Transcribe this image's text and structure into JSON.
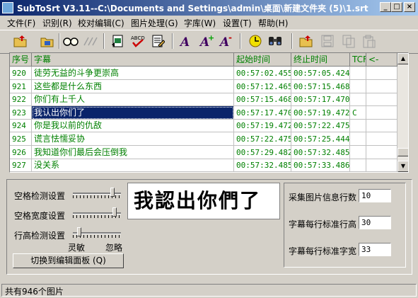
{
  "window": {
    "title": "SubToSrt V3.11--C:\\Documents and Settings\\admin\\桌面\\新建文件夹 (5)\\1.srt",
    "min_glyph": "_",
    "max_glyph": "□",
    "close_glyph": "×"
  },
  "menu": [
    "文件(F)",
    "识别(R)",
    "校对编辑(C)",
    "图片处理(G)",
    "字库(W)",
    "设置(T)",
    "帮助(H)"
  ],
  "toolbar_icons": [
    "open-folder-icon",
    "save-icon",
    "glasses-icon",
    "glasses-disabled-icon",
    "export-icon",
    "spellcheck-icon",
    "edit-doc-icon",
    "font-a-icon",
    "font-a-plus-icon",
    "font-a-minus-icon",
    "clock-icon",
    "binoculars-icon",
    "open-folder-2-icon",
    "disk-disabled-icon",
    "copy-disabled-icon",
    "paste-disabled-icon"
  ],
  "table": {
    "headers": [
      "序号",
      "字幕",
      "起始时间",
      "终止时间",
      "TCF",
      "<-"
    ],
    "rows": [
      {
        "no": "920",
        "text": "徒劳无益的斗争更崇高",
        "start": "00:57:02.455",
        "end": "00:57:05.424",
        "tcf": ""
      },
      {
        "no": "921",
        "text": "这些都是什么东西",
        "start": "00:57:12.465",
        "end": "00:57:15.468",
        "tcf": ""
      },
      {
        "no": "922",
        "text": "你们有上千人",
        "start": "00:57:15.468",
        "end": "00:57:17.470",
        "tcf": ""
      },
      {
        "no": "923",
        "text": "我认出你们了",
        "start": "00:57:17.470",
        "end": "00:57:19.472",
        "tcf": "C"
      },
      {
        "no": "924",
        "text": "你是我以前的仇敌",
        "start": "00:57:19.472",
        "end": "00:57:22.475",
        "tcf": ""
      },
      {
        "no": "925",
        "text": "谎言怯懦妥协",
        "start": "00:57:22.475",
        "end": "00:57:25.444",
        "tcf": ""
      },
      {
        "no": "926",
        "text": "我知道你们最后会压倒我",
        "start": "00:57:29.482",
        "end": "00:57:32.485",
        "tcf": ""
      },
      {
        "no": "927",
        "text": "没关系",
        "start": "00:57:32.485",
        "end": "00:57:33.486",
        "tcf": ""
      }
    ],
    "selected_index": 3
  },
  "panel": {
    "space_detect_label": "空格检测设置",
    "space_width_label": "空格宽度设置",
    "line_height_label": "行高检测设置",
    "sensitive_label": "灵敏",
    "ignore_label": "忽略",
    "switch_button": "切换到编辑面板 (Q)",
    "preview_text": "我認出你們了",
    "sample_rows_label": "采集图片信息行数",
    "sample_rows_value": "10",
    "std_height_label": "字幕每行标准行高",
    "std_height_value": "30",
    "std_width_label": "字幕每行标准字宽",
    "std_width_value": "33"
  },
  "slider_levels": {
    "space_detect": 0.85,
    "space_width": 0.9,
    "line_height": 0.1
  },
  "status": {
    "text": "共有946个图片"
  },
  "colors": {
    "accent_text": "#008000",
    "selection": "#0a246a",
    "titlebar": "#0a246a"
  }
}
